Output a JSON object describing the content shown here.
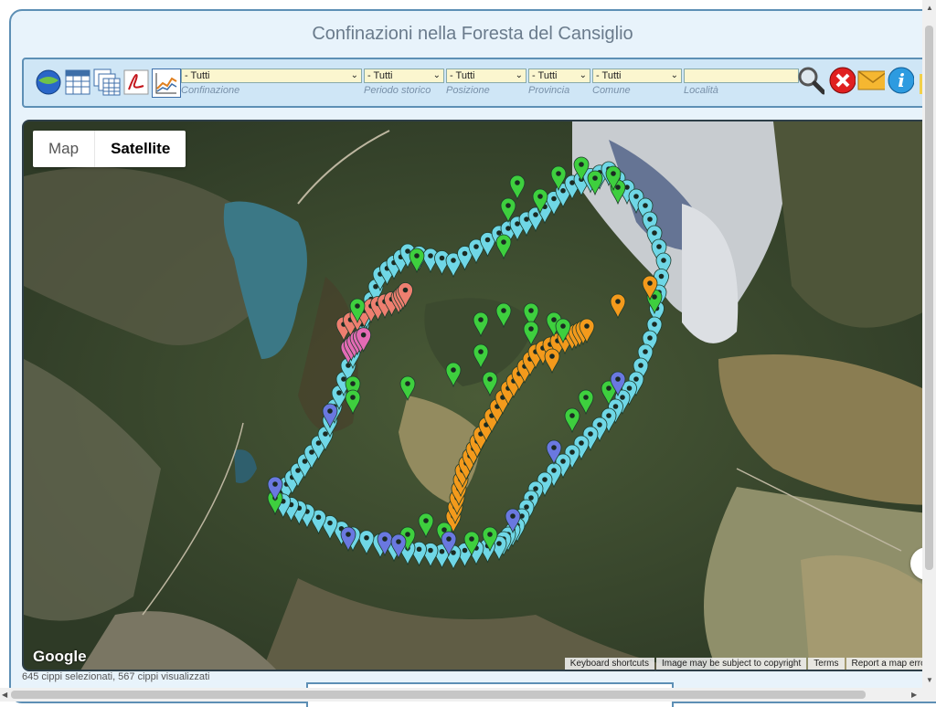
{
  "page": {
    "title": "Confinazioni nella Foresta del Cansiglio"
  },
  "toolbar": {
    "icons": [
      "google-earth-icon",
      "table-icon",
      "multi-table-icon",
      "pdf-icon",
      "chart-icon"
    ],
    "filters": [
      {
        "value": "- Tutti",
        "label": "Confinazione"
      },
      {
        "value": "- Tutti",
        "label": "Periodo storico"
      },
      {
        "value": "- Tutti",
        "label": "Posizione"
      },
      {
        "value": "- Tutti",
        "label": "Provincia"
      },
      {
        "value": "- Tutti",
        "label": "Comune"
      }
    ],
    "location": {
      "value": "",
      "label": "Località"
    },
    "actions": [
      "search-icon",
      "clear-icon",
      "mail-icon",
      "info-icon"
    ]
  },
  "map": {
    "map_type": {
      "map": "Map",
      "satellite": "Satellite"
    },
    "logo": "Google",
    "attribution": [
      "Keyboard shortcuts",
      "Image may be subject to copyright",
      "Terms",
      "Report a map error"
    ],
    "marker_colors": {
      "green": "#3ecf3e",
      "cyan": "#6fd7e6",
      "blue": "#6a78e0",
      "orange": "#f39a1c",
      "salmon": "#ee7f70",
      "pink": "#e36bb4"
    }
  },
  "status": "645 cippi selezionati, 567 cippi visualizzati"
}
